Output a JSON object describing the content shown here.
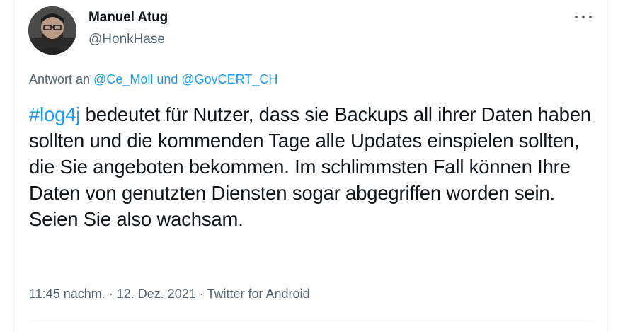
{
  "author": {
    "name": "Manuel Atug",
    "handle": "@HonkHase"
  },
  "icons": {
    "more": "more-horizontal-icon"
  },
  "reply": {
    "prefix": "Antwort an ",
    "user1": "@Ce_Moll",
    "conjunction": " und ",
    "user2": "@GovCERT_CH"
  },
  "tweet": {
    "hashtag": "#log4j",
    "text": " bedeutet für Nutzer, dass sie Backups all ihrer Daten haben sollten und die kommenden Tage alle Updates einspielen sollten, die Sie angeboten bekommen. Im schlimmsten Fall können Ihre Daten von genutzten Diensten sogar abgegriffen worden sein. Seien Sie also wachsam."
  },
  "meta": {
    "time": "11:45 nachm.",
    "separator1": " · ",
    "date": "12. Dez. 2021",
    "separator2": " · ",
    "source": "Twitter for Android"
  },
  "colors": {
    "link": "#1d9bf0",
    "secondary_text": "#536471",
    "primary_text": "#0f1419"
  }
}
